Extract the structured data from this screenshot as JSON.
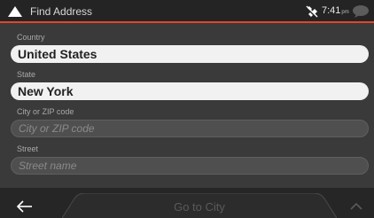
{
  "header": {
    "title": "Find Address",
    "gps_icon": "satellite-no-fix-icon",
    "time": "7:41",
    "time_suffix": "pm",
    "message_icon": "message-bubble-icon",
    "accent_color": "#e2462a"
  },
  "form": {
    "country": {
      "label": "Country",
      "value": "United States"
    },
    "state": {
      "label": "State",
      "value": "New York"
    },
    "city": {
      "label": "City or ZIP code",
      "placeholder": "City or ZIP code",
      "value": ""
    },
    "street": {
      "label": "Street",
      "placeholder": "Street name",
      "value": ""
    }
  },
  "bottom_bar": {
    "back_icon": "left-arrow-icon",
    "primary_label": "Go to City",
    "primary_enabled": false,
    "expand_icon": "chevron-up-icon"
  }
}
